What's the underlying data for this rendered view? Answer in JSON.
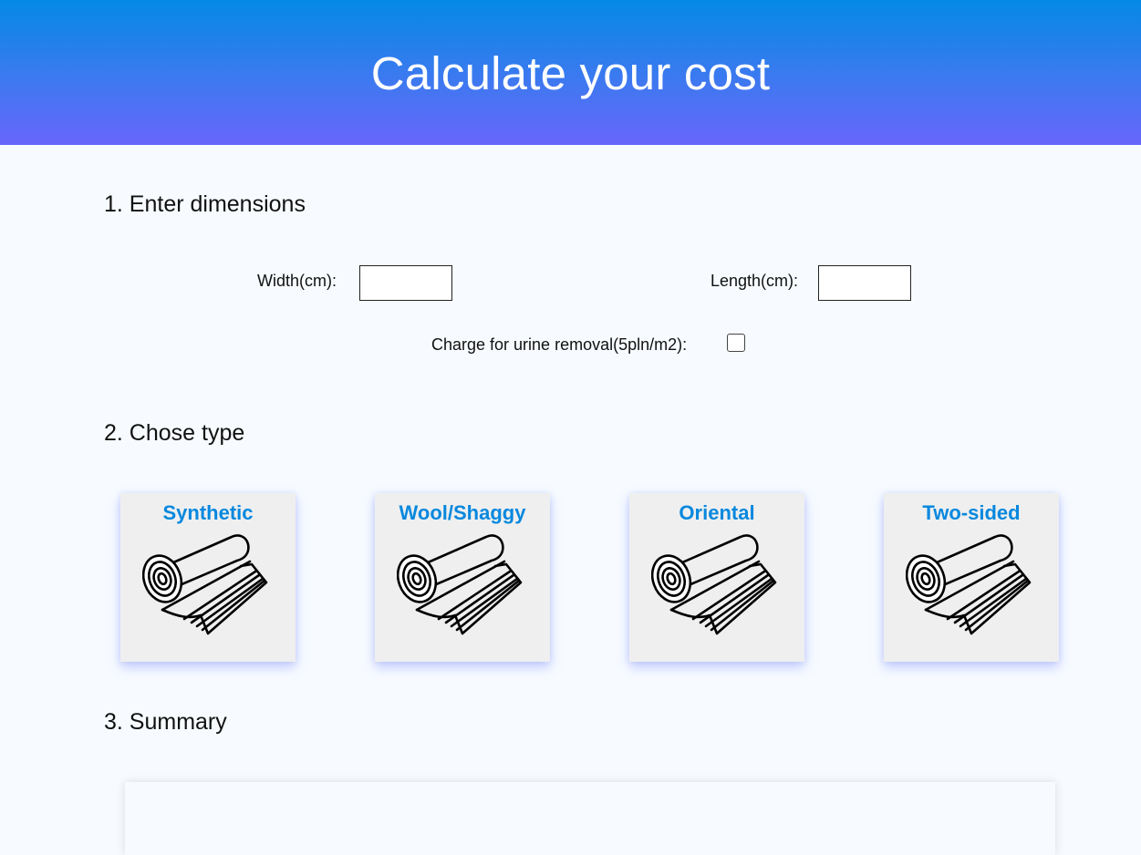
{
  "header": {
    "title": "Calculate your cost",
    "gradient_top": "#0489e6",
    "gradient_bottom": "#6866fb"
  },
  "sections": {
    "dimensions": {
      "title": "1. Enter dimensions",
      "width_label": "Width(cm):",
      "width_value": "",
      "length_label": "Length(cm):",
      "length_value": "",
      "urine_label": "Charge for urine removal(5pln/m2):",
      "urine_checked": false
    },
    "type": {
      "title": "2. Chose type",
      "options": [
        {
          "label": "Synthetic",
          "icon": "rug-roll-icon"
        },
        {
          "label": "Wool/Shaggy",
          "icon": "rug-roll-icon"
        },
        {
          "label": "Oriental",
          "icon": "rug-roll-icon"
        },
        {
          "label": "Two-sided",
          "icon": "rug-roll-icon"
        }
      ],
      "label_color": "#0788de"
    },
    "summary": {
      "title": "3. Summary"
    }
  }
}
